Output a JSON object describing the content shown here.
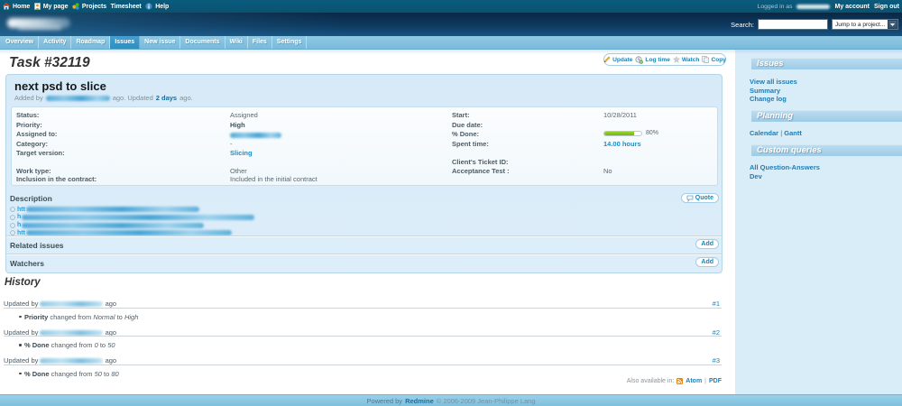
{
  "top_menu": {
    "items": [
      {
        "label": "Home",
        "icon": "home-icon"
      },
      {
        "label": "My page",
        "icon": "mypage-icon"
      },
      {
        "label": "Projects",
        "icon": "projects-icon"
      },
      {
        "label": "Timesheet",
        "icon": null
      },
      {
        "label": "Help",
        "icon": "help-icon"
      }
    ],
    "logged_in_label": "Logged in as",
    "user_redacted": true,
    "account_link": "My account",
    "signout_link": "Sign out"
  },
  "header": {
    "logo_redacted": true,
    "search_label": "Search:",
    "search_value": "",
    "project_select_value": "Jump to a project..."
  },
  "tabs": {
    "items": [
      {
        "label": "Overview",
        "selected": false
      },
      {
        "label": "Activity",
        "selected": false
      },
      {
        "label": "Roadmap",
        "selected": false
      },
      {
        "label": "Issues",
        "selected": true
      },
      {
        "label": "New issue",
        "selected": false
      },
      {
        "label": "Documents",
        "selected": false
      },
      {
        "label": "Wiki",
        "selected": false
      },
      {
        "label": "Files",
        "selected": false
      },
      {
        "label": "Settings",
        "selected": false
      }
    ]
  },
  "page": {
    "title": "Task #32119"
  },
  "contextual": {
    "buttons": [
      {
        "label": "Update",
        "icon": "pencil-icon"
      },
      {
        "label": "Log time",
        "icon": "log-time-icon"
      },
      {
        "label": "Watch",
        "icon": "star-icon"
      },
      {
        "label": "Copy",
        "icon": "copy-icon"
      }
    ]
  },
  "issue": {
    "subject": "next psd to slice",
    "meta": {
      "added_by": "Added by",
      "author_redacted": true,
      "middle": "ago. Updated",
      "updated_link": "2 days",
      "suffix": "ago."
    },
    "attributes": {
      "rows": [
        {
          "label1": "Status:",
          "value1": "Assigned",
          "label2": "Start:",
          "value2": "10/28/2011"
        },
        {
          "label1": "Priority:",
          "value1": "High",
          "label2": "Due date:",
          "value2": ""
        },
        {
          "label1": "Assigned to:",
          "value1_redacted": true,
          "label2": "% Done:",
          "value2_progress": true
        },
        {
          "label1": "Category:",
          "value1": "-",
          "label2": "Spent time:",
          "value2_link": "14.00 hours"
        },
        {
          "label1": "Target version:",
          "value1_link": "Slicing",
          "label2": "",
          "value2": ""
        },
        {
          "label1": "",
          "value1": "",
          "label2": "Client's Ticket ID:",
          "value2": ""
        },
        {
          "label1": "Work type:",
          "value1": "Other",
          "label2": "Acceptance Test :",
          "value2": "No"
        },
        {
          "label1": "Inclusion in the contract:",
          "value1": "Included in the initial contract",
          "label2": "",
          "value2": ""
        }
      ]
    },
    "progress": {
      "percent": 80,
      "text": "80%"
    },
    "description": {
      "title": "Description",
      "quote_label": "Quote",
      "links": [
        {
          "prefix": "htt",
          "redacted": true,
          "blur_width": 192
        },
        {
          "prefix": "h",
          "redacted": true,
          "blur_width": 258
        },
        {
          "prefix": "h",
          "redacted": true,
          "blur_width": 202
        },
        {
          "prefix": "htt",
          "redacted": true,
          "blur_width": 228
        }
      ]
    },
    "sections": [
      {
        "title": "Related issues",
        "action": "Add"
      },
      {
        "title": "Watchers",
        "action": "Add"
      }
    ]
  },
  "history": {
    "title": "History",
    "entries": [
      {
        "updated_by": "Updated by",
        "author_redacted": true,
        "ago": "ago",
        "number": "#1",
        "field": "Priority",
        "changed": "changed from",
        "old": "Normal",
        "to": "to",
        "new": "High"
      },
      {
        "updated_by": "Updated by",
        "author_redacted": true,
        "ago": "ago",
        "number": "#2",
        "field": "% Done",
        "changed": "changed from",
        "old": "0",
        "to": "to",
        "new": "50"
      },
      {
        "updated_by": "Updated by",
        "author_redacted": true,
        "ago": "ago",
        "number": "#3",
        "field": "% Done",
        "changed": "changed from",
        "old": "50",
        "to": "to",
        "new": "80"
      }
    ],
    "other_formats": {
      "label": "Also available in:",
      "atom": "Atom",
      "sep": "|",
      "pdf": "PDF"
    }
  },
  "sidebar": {
    "sections": [
      {
        "title": "Issues",
        "links": [
          "View all issues",
          "Summary",
          "Change log"
        ]
      },
      {
        "title": "Planning",
        "links": [
          "Calendar",
          "Gantt"
        ],
        "inline_sep": "|"
      },
      {
        "title": "Custom queries",
        "links": [
          "All Question-Answers",
          "Dev"
        ]
      }
    ]
  },
  "footer": {
    "powered_by": "Powered by",
    "redmine_link": "Redmine",
    "copyright": "© 2006-2009 Jean-Philippe Lang"
  },
  "colors": {
    "top_menu_bg": "#0a5778",
    "header_dark": "#0a2845",
    "header_light": "#175381",
    "tabs_bg": "#84c1de",
    "tab_selected_bg": "#2d8fc2",
    "sidebar_bg": "#d9edf8",
    "band_bg": "#a6d2ea",
    "issue_box_bg": "#dbecf8",
    "link_blue": "#1b7db5",
    "progress_green": "#86c11d",
    "footer_bg": "#8cc7e3"
  }
}
